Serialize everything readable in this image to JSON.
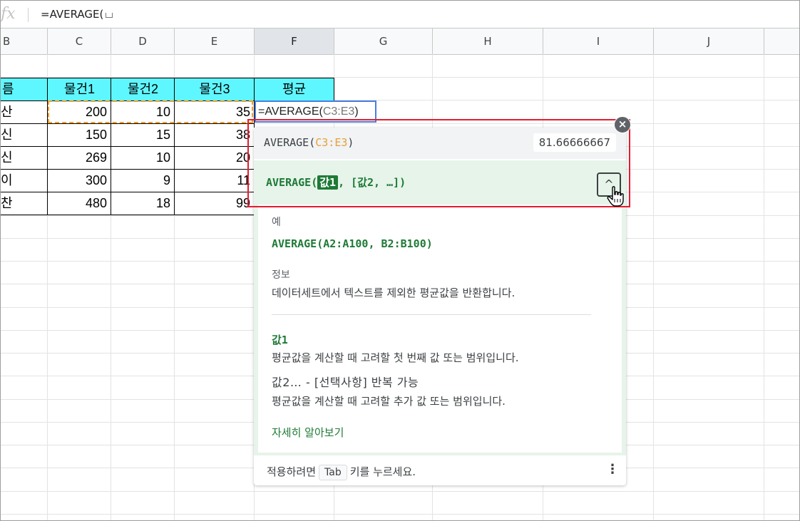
{
  "formula_bar": {
    "fx_label": "fx",
    "text": "=AVERAGE("
  },
  "columns": [
    "B",
    "C",
    "D",
    "E",
    "F",
    "G",
    "H",
    "I",
    "J"
  ],
  "table": {
    "headers": [
      "름",
      "물건1",
      "물건2",
      "물건3",
      "평균"
    ],
    "rows": [
      {
        "name": "산",
        "v1": "200",
        "v2": "10",
        "v3": "35"
      },
      {
        "name": "신",
        "v1": "150",
        "v2": "15",
        "v3": "38"
      },
      {
        "name": "신",
        "v1": "269",
        "v2": "10",
        "v3": "20"
      },
      {
        "name": "이",
        "v1": "300",
        "v2": "9",
        "v3": "11"
      },
      {
        "name": "찬",
        "v1": "480",
        "v2": "18",
        "v3": "99"
      }
    ]
  },
  "edit_cell": {
    "prefix": "=AVERAGE(",
    "range": "C3:E3",
    "suffix": ")"
  },
  "popup": {
    "summary": {
      "func": "AVERAGE(",
      "range": "C3:E3",
      "close": ")",
      "value": "81.66666667"
    },
    "signature": {
      "func": "AVERAGE(",
      "arg1": "값1",
      "rest": ", [값2, …])"
    },
    "example_label": "예",
    "example_code": "AVERAGE(A2:A100, B2:B100)",
    "info_label": "정보",
    "info_text": "데이터세트에서 텍스트를 제외한 평균값을 반환합니다.",
    "arg1_name": "값1",
    "arg1_desc": "평균값을 계산할 때 고려할 첫 번째 값 또는 범위입니다.",
    "arg2_name": "값2… - [선택사항] 반복 가능",
    "arg2_desc": "평균값을 계산할 때 고려할 추가 값 또는 범위입니다.",
    "learn_more": "자세히 알아보기",
    "footer_prefix": "적용하려면",
    "footer_key": "Tab",
    "footer_suffix": "키를 누르세요."
  },
  "colors": {
    "header_fill": "#5ff7ff",
    "accent_green": "#1e7a36",
    "highlight_red": "#e41c2e",
    "edit_blue": "#4a7de0",
    "copy_orange": "#f59b23"
  }
}
